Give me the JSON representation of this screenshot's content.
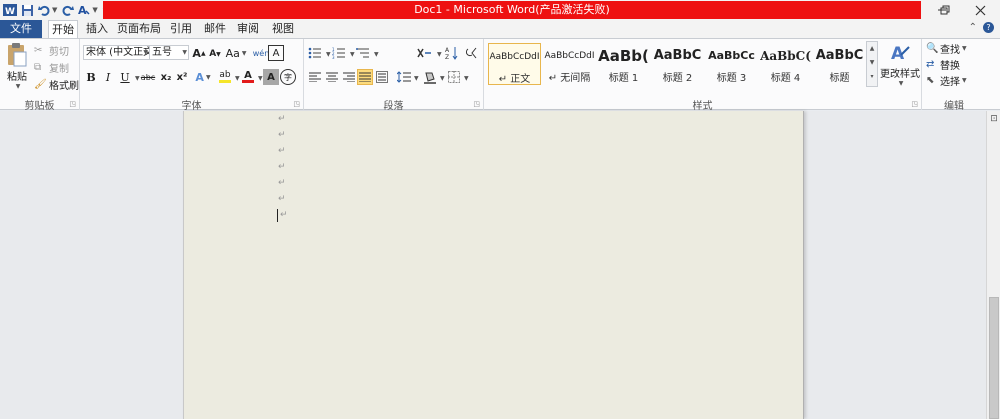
{
  "window": {
    "title": "Doc1 - Microsoft Word(产品激活失败)"
  },
  "tabs": {
    "file": "文件",
    "items": [
      "开始",
      "插入",
      "页面布局",
      "引用",
      "邮件",
      "审阅",
      "视图"
    ],
    "active": "开始"
  },
  "clipboard": {
    "paste": "粘贴",
    "cut": "剪切",
    "copy": "复制",
    "format_painter": "格式刷",
    "label": "剪贴板"
  },
  "font": {
    "name": "宋体 (中文正文)",
    "size": "五号",
    "grow": "A",
    "shrink": "A",
    "change_case": "Aa",
    "phonetic": "wén",
    "enclose": "A",
    "bold": "B",
    "italic": "I",
    "underline": "U",
    "strike": "abc",
    "subscript": "x₂",
    "superscript": "x²",
    "text_effect": "A",
    "highlight": "ab",
    "color": "A",
    "shading": "A",
    "enclosed_char": "字",
    "label": "字体",
    "highlight_color": "#f5e52a",
    "font_color": "#e21b1b"
  },
  "paragraph": {
    "label": "段落"
  },
  "styles": {
    "label": "样式",
    "items": [
      {
        "preview": "AaBbCcDdI",
        "name": "正文",
        "selected": true
      },
      {
        "preview": "AaBbCcDdI",
        "name": "无间隔"
      },
      {
        "preview": "AaBb(",
        "name": "标题 1"
      },
      {
        "preview": "AaBbC",
        "name": "标题 2"
      },
      {
        "preview": "AaBbCc",
        "name": "标题 3"
      },
      {
        "preview": "AaBbC(",
        "name": "标题 4"
      },
      {
        "preview": "AaBbC",
        "name": "标题"
      }
    ],
    "change_styles": "更改样式"
  },
  "editing": {
    "find": "查找",
    "replace": "替换",
    "select": "选择",
    "label": "编辑"
  },
  "document": {
    "paragraph_mark": "↵"
  }
}
